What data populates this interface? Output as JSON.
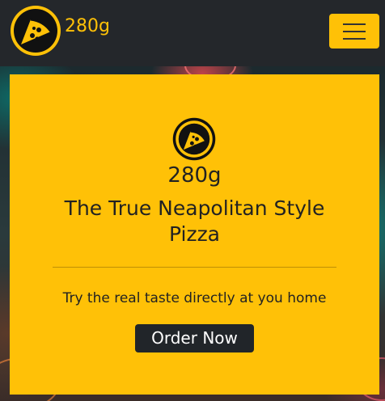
{
  "navbar": {
    "brand_name": "280g",
    "logo_icon": "pizza-slice-icon",
    "toggler_icon": "hamburger-menu-icon"
  },
  "hero": {
    "brand_name": "280g",
    "title": "The True Neapolitan Style Pizza",
    "subtitle": "Try the real taste directly at you home",
    "cta_label": "Order Now"
  },
  "colors": {
    "accent": "#ffc107",
    "dark": "#212529"
  }
}
